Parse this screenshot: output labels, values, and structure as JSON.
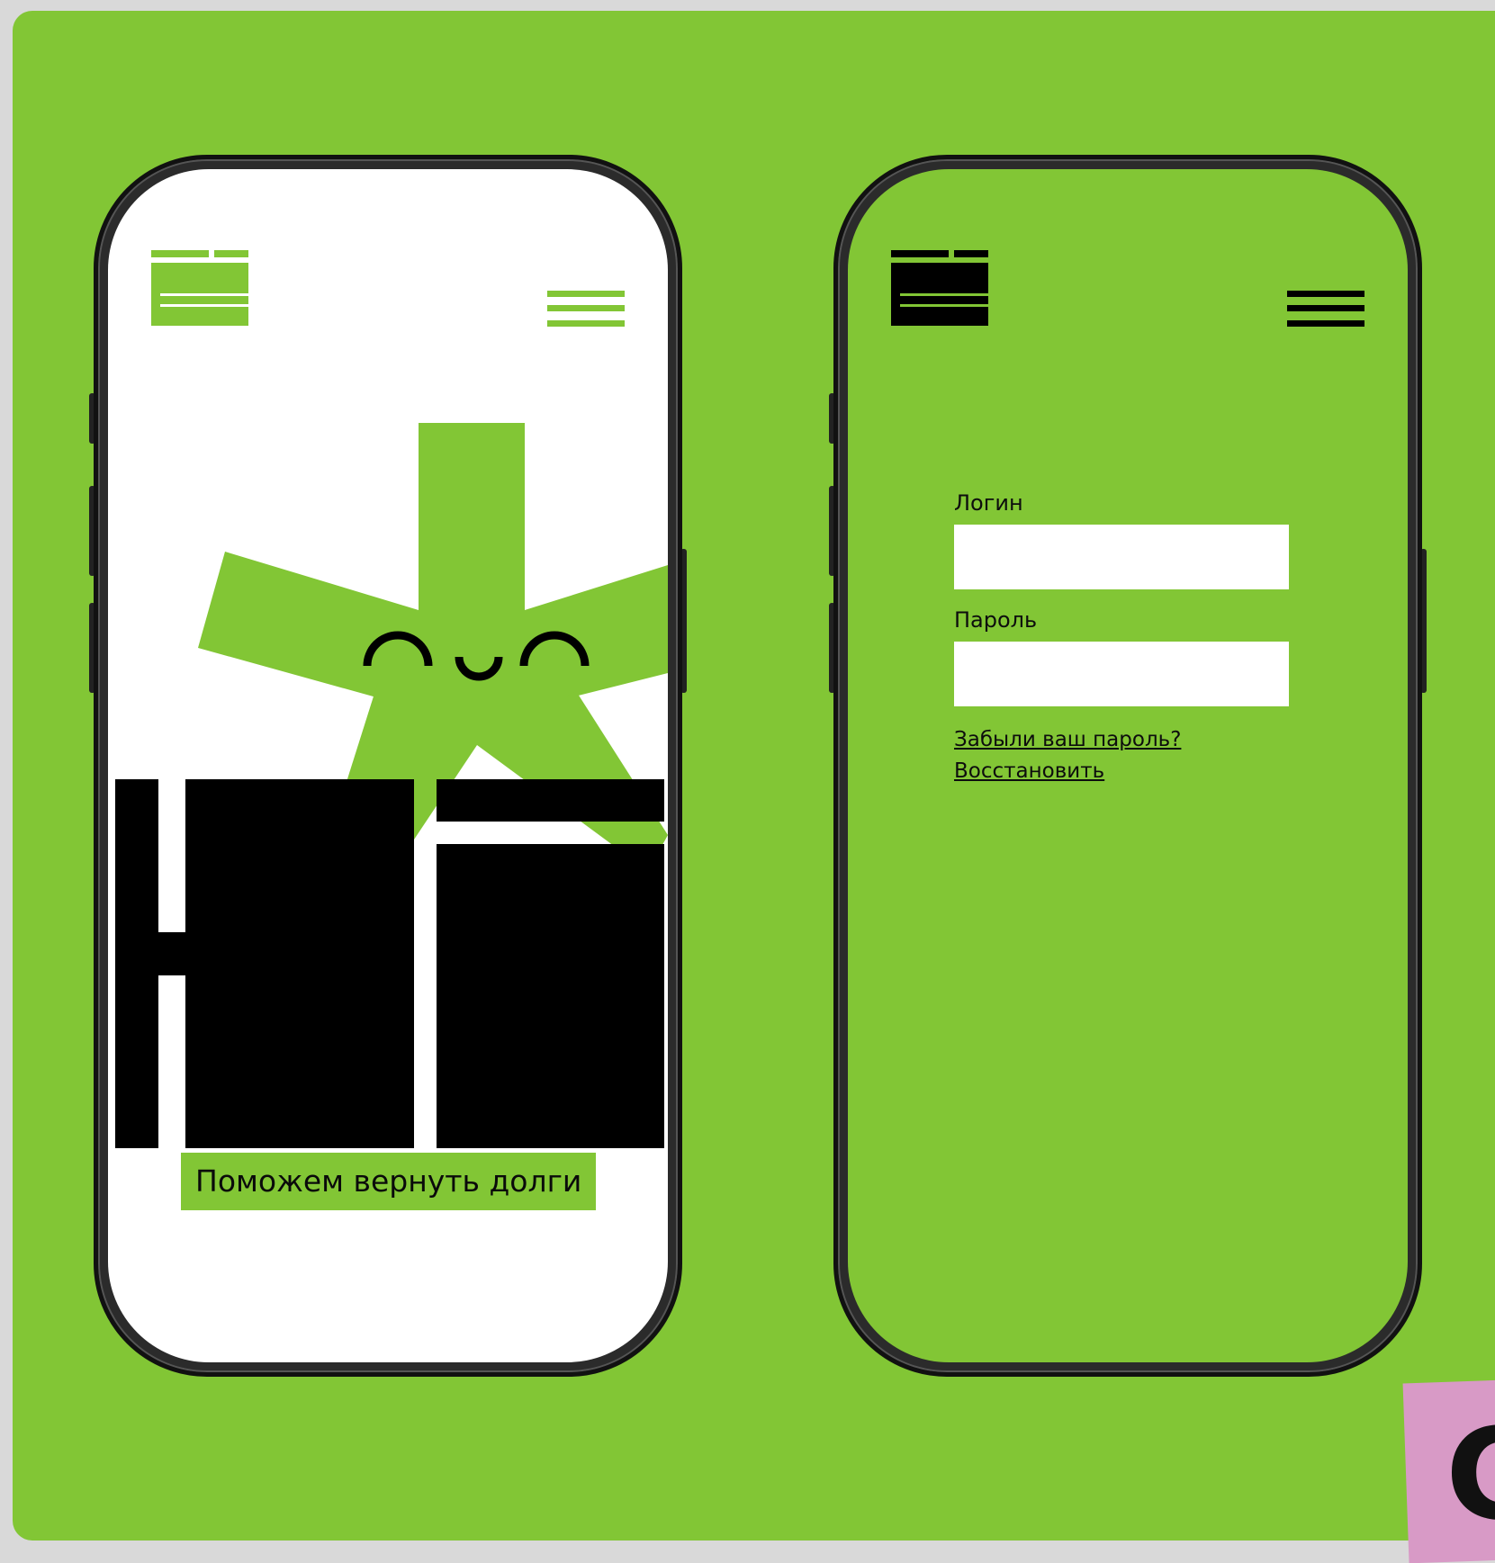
{
  "left_screen": {
    "tagline": "Поможем вернуть долги"
  },
  "right_screen": {
    "login_label": "Логин",
    "login_value": "",
    "password_label": "Пароль",
    "password_value": "",
    "forgot_link": "Забыли ваш пароль?",
    "restore_link": "Восстановить"
  },
  "sticky_note": {
    "letter": "C"
  },
  "colors": {
    "brand_green": "#82c635",
    "black": "#000000",
    "white": "#ffffff",
    "sticky_pink": "#d89ac6"
  }
}
